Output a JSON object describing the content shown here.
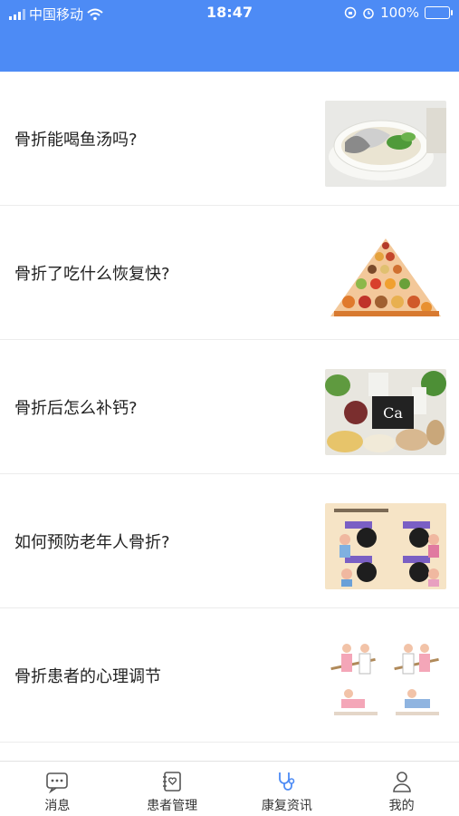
{
  "status_bar": {
    "carrier": "中国移动",
    "time": "18:47",
    "battery": "100%"
  },
  "articles": [
    {
      "title": "骨折能喝鱼汤吗?",
      "image_icon": "fish-soup"
    },
    {
      "title": "骨折了吃什么恢复快?",
      "image_icon": "food-pyramid"
    },
    {
      "title": "骨折后怎么补钙?",
      "image_icon": "calcium-foods",
      "image_text": "Ca"
    },
    {
      "title": "如何预防老年人骨折?",
      "image_icon": "elderly-fall-prevention"
    },
    {
      "title": "骨折患者的心理调节",
      "image_icon": "rehab-exercise"
    }
  ],
  "tabbar": {
    "tabs": [
      {
        "label": "消息",
        "icon": "message-icon"
      },
      {
        "label": "患者管理",
        "icon": "patient-icon"
      },
      {
        "label": "康复资讯",
        "icon": "stethoscope-icon",
        "active": true
      },
      {
        "label": "我的",
        "icon": "user-icon"
      }
    ]
  },
  "colors": {
    "header": "#4D8BF5",
    "active_icon": "#4D8BF5",
    "inactive_icon": "#555555"
  }
}
